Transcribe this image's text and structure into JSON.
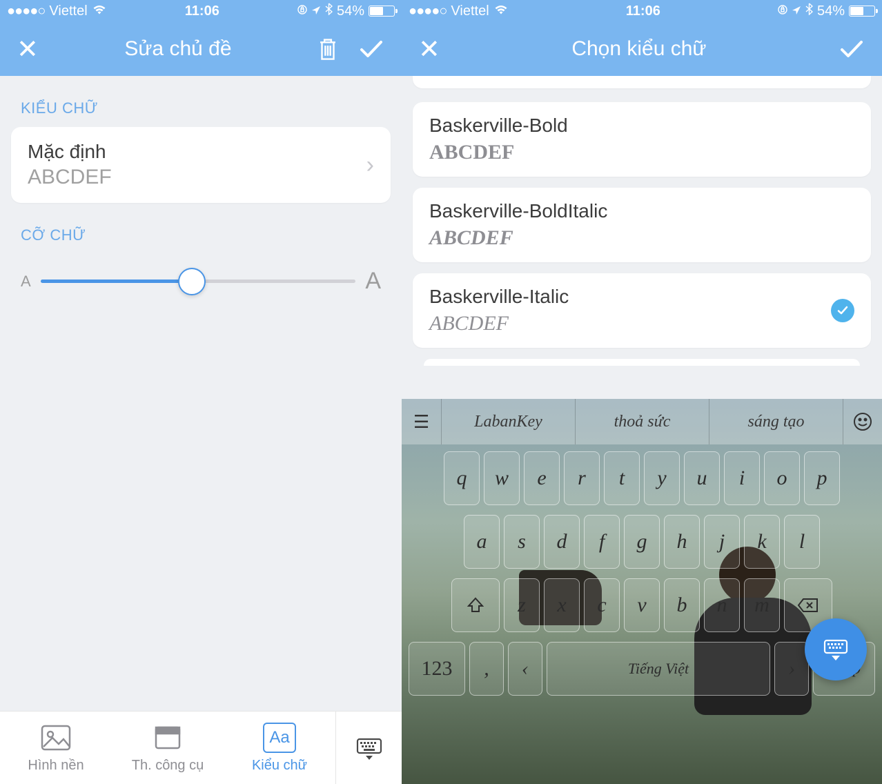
{
  "status": {
    "carrier": "Viettel",
    "time": "11:06",
    "battery_pct": "54%"
  },
  "left": {
    "title": "Sửa chủ đề",
    "section_font": "KIỂU CHỮ",
    "font_value": "Mặc định",
    "font_preview": "ABCDEF",
    "section_size": "CỠ CHỮ",
    "tabs": {
      "bg": "Hình nền",
      "toolbar": "Th. công cụ",
      "font": "Kiểu chữ"
    }
  },
  "right": {
    "title": "Chọn kiểu chữ",
    "fonts": [
      {
        "name": "Baskerville-Bold",
        "preview": "ABCDEF",
        "selected": false
      },
      {
        "name": "Baskerville-BoldItalic",
        "preview": "ABCDEF",
        "selected": false
      },
      {
        "name": "Baskerville-Italic",
        "preview": "ABCDEF",
        "selected": true
      }
    ]
  },
  "keyboard": {
    "suggestions": [
      "LabanKey",
      "thoả sức",
      "sáng tạo"
    ],
    "row1": [
      "q",
      "w",
      "e",
      "r",
      "t",
      "y",
      "u",
      "i",
      "o",
      "p"
    ],
    "row2": [
      "a",
      "s",
      "d",
      "f",
      "g",
      "h",
      "j",
      "k",
      "l"
    ],
    "row3": [
      "z",
      "x",
      "c",
      "v",
      "b",
      "n",
      "m"
    ],
    "num_key": "123",
    "comma_key": ",",
    "space_label": "Tiếng Việt",
    "enter_label": "Nhập"
  }
}
